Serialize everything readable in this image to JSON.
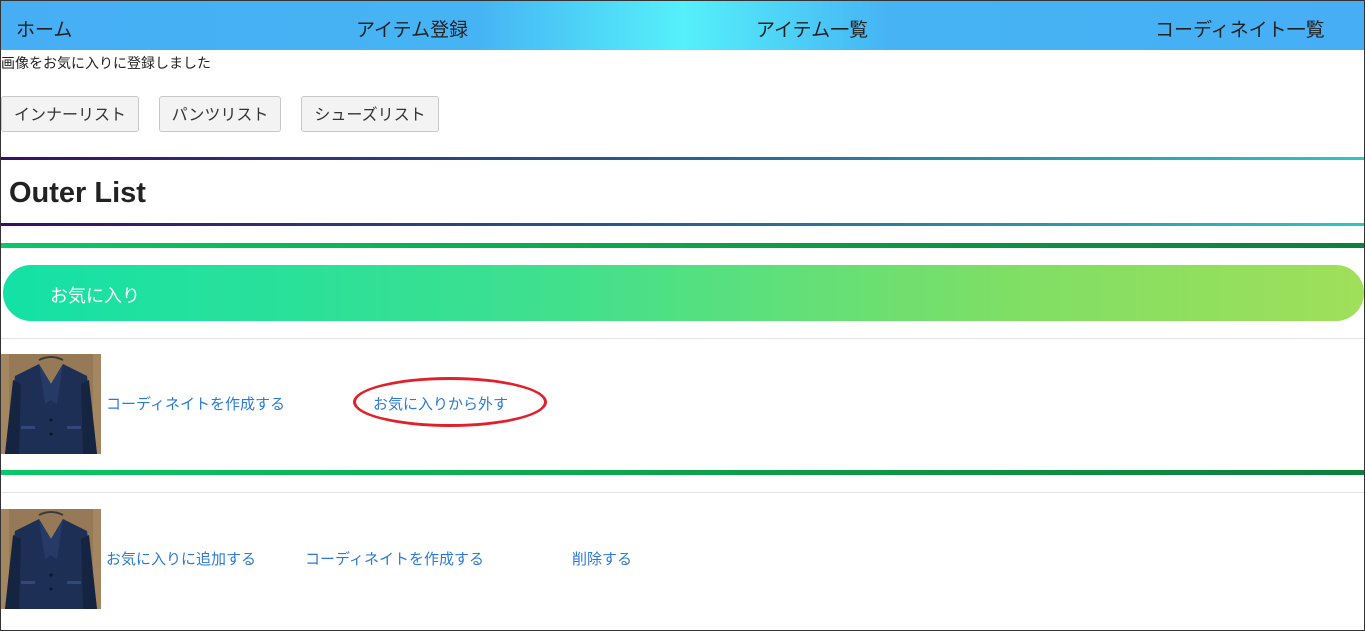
{
  "nav": {
    "home": "ホーム",
    "register": "アイテム登録",
    "item_list": "アイテム一覧",
    "coordinate_list": "コーディネイト一覧"
  },
  "flash_message": "画像をお気に入りに登録しました",
  "list_buttons": {
    "inner": "インナーリスト",
    "pants": "パンツリスト",
    "shoes": "シューズリスト"
  },
  "page_title": "Outer List",
  "favorites_section": {
    "heading": "お気に入り",
    "items": [
      {
        "image_icon": "jacket-photo",
        "create_coordinate": "コーディネイトを作成する",
        "remove_favorite": "お気に入りから外す"
      }
    ]
  },
  "items": [
    {
      "image_icon": "jacket-photo",
      "add_favorite": "お気に入りに追加する",
      "create_coordinate": "コーディネイトを作成する",
      "delete": "削除する"
    }
  ],
  "colors": {
    "navbar_accent": "#46aef5",
    "link": "#2b7bd6",
    "banner_start": "#14e1a6",
    "banner_end": "#a0df5a",
    "annotation": "#e0202a"
  }
}
